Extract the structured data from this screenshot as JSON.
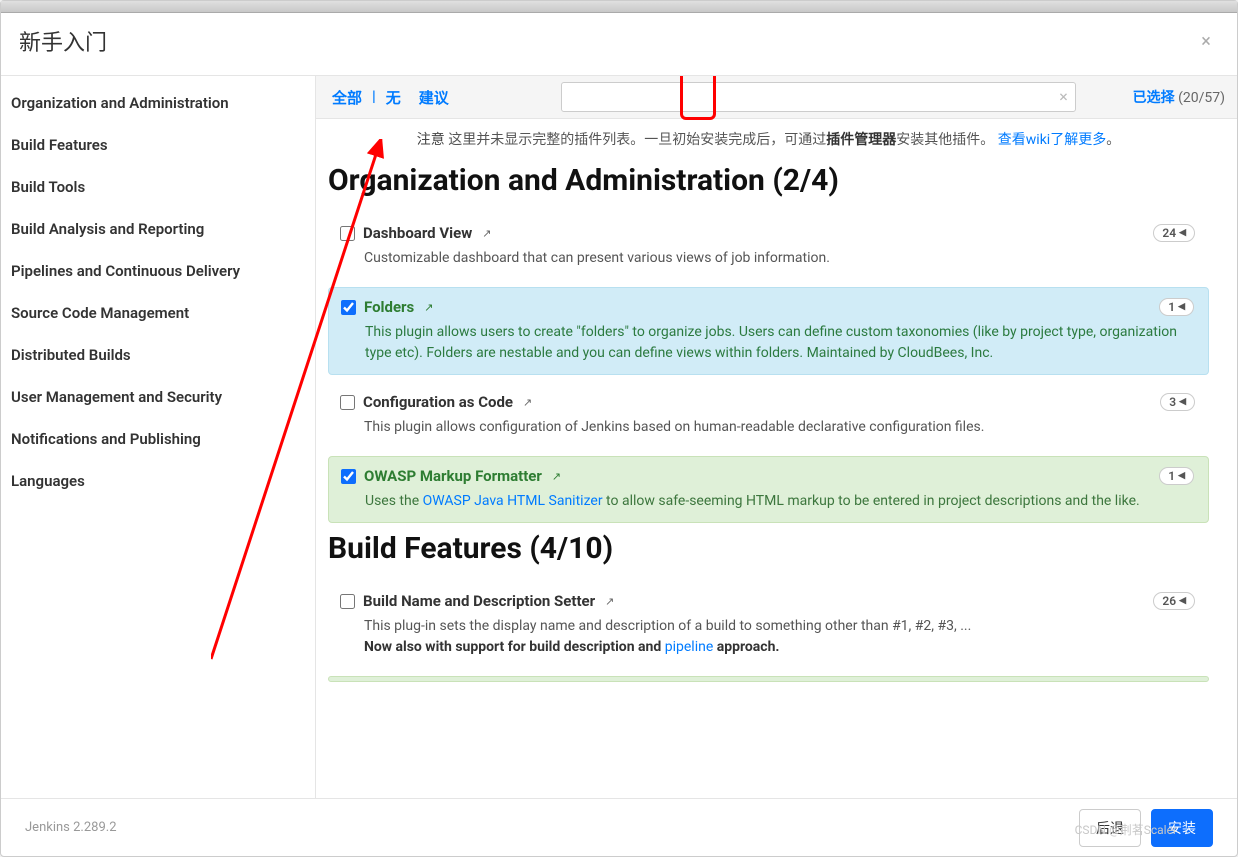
{
  "header": {
    "title": "新手入门"
  },
  "sidebar": {
    "items": [
      {
        "label": "Organization and Administration"
      },
      {
        "label": "Build Features"
      },
      {
        "label": "Build Tools"
      },
      {
        "label": "Build Analysis and Reporting"
      },
      {
        "label": "Pipelines and Continuous Delivery"
      },
      {
        "label": "Source Code Management"
      },
      {
        "label": "Distributed Builds"
      },
      {
        "label": "User Management and Security"
      },
      {
        "label": "Notifications and Publishing"
      },
      {
        "label": "Languages"
      }
    ]
  },
  "topbar": {
    "all": "全部",
    "none": "无",
    "suggest": "建议",
    "selected_label": "已选择",
    "selected_count": "(20/57)"
  },
  "notice": {
    "prefix": "注意",
    "mid1": "这里并未显示完整的插件列表。一旦初始安装完成后，可通过",
    "bold": "插件管理器",
    "mid2": "安装其他插件。",
    "link": "查看wiki了解更多",
    "tail": "。"
  },
  "sections": {
    "org": {
      "heading": "Organization and Administration (2/4)",
      "plugins": [
        {
          "title": "Dashboard View",
          "badge": "24",
          "desc": "Customizable dashboard that can present various views of job information."
        },
        {
          "title": "Folders",
          "badge": "1",
          "desc": "This plugin allows users to create \"folders\" to organize jobs. Users can define custom taxonomies (like by project type, organization type etc). Folders are nestable and you can define views within folders. Maintained by CloudBees, Inc."
        },
        {
          "title": "Configuration as Code",
          "badge": "3",
          "desc": "This plugin allows configuration of Jenkins based on human-readable declarative configuration files."
        },
        {
          "title": "OWASP Markup Formatter",
          "badge": "1",
          "desc_pre": "Uses the ",
          "desc_link": "OWASP Java HTML Sanitizer",
          "desc_post": " to allow safe-seeming HTML markup to be entered in project descriptions and the like."
        }
      ]
    },
    "build": {
      "heading": "Build Features (4/10)",
      "plugins": [
        {
          "title": "Build Name and Description Setter",
          "badge": "26",
          "line1": "This plug-in sets the display name and description of a build to something other than #1, #2, #3, ...",
          "line2_pre": "Now also with support for build description and ",
          "line2_link": "pipeline",
          "line2_post": " approach."
        }
      ]
    }
  },
  "footer": {
    "version": "Jenkins 2.289.2",
    "back": "后退",
    "install": "安装"
  },
  "watermark": "CSDN @荆茗Scaler"
}
